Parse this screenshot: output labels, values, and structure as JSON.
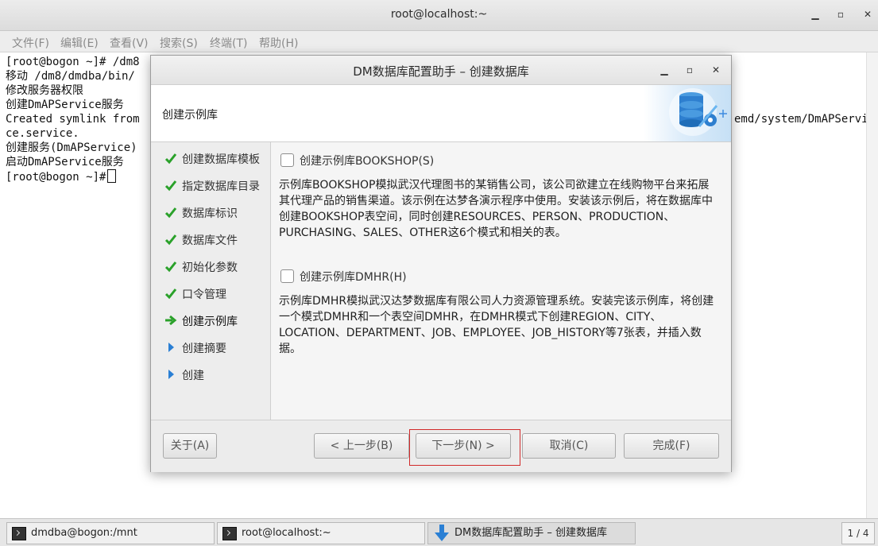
{
  "terminal": {
    "title": "root@localhost:~",
    "menu": [
      "文件(F)",
      "编辑(E)",
      "查看(V)",
      "搜索(S)",
      "终端(T)",
      "帮助(H)"
    ],
    "lines": [
      "[root@bogon ~]# /dm8",
      "移动 /dm8/dmdba/bin/",
      "修改服务器权限",
      "创建DmAPService服务",
      "Created symlink from",
      "ce.service.",
      "创建服务(DmAPService)",
      "启动DmAPService服务",
      "[root@bogon ~]#"
    ],
    "right_fragment": "emd/system/DmAPServi"
  },
  "dialog": {
    "title": "DM数据库配置助手 – 创建数据库",
    "header_title": "创建示例库",
    "steps": [
      {
        "label": "创建数据库模板",
        "status": "done"
      },
      {
        "label": "指定数据库目录",
        "status": "done"
      },
      {
        "label": "数据库标识",
        "status": "done"
      },
      {
        "label": "数据库文件",
        "status": "done"
      },
      {
        "label": "初始化参数",
        "status": "done"
      },
      {
        "label": "口令管理",
        "status": "done"
      },
      {
        "label": "创建示例库",
        "status": "current"
      },
      {
        "label": "创建摘要",
        "status": "pending"
      },
      {
        "label": "创建",
        "status": "pending"
      }
    ],
    "option_bookshop": {
      "label": "创建示例库BOOKSHOP(S)",
      "checked": false,
      "description": "示例库BOOKSHOP模拟武汉代理图书的某销售公司，该公司欲建立在线购物平台来拓展其代理产品的销售渠道。该示例在达梦各演示程序中使用。安装该示例后，将在数据库中创建BOOKSHOP表空间，同时创建RESOURCES、PERSON、PRODUCTION、PURCHASING、SALES、OTHER这6个模式和相关的表。"
    },
    "option_dmhr": {
      "label": "创建示例库DMHR(H)",
      "checked": false,
      "description": "示例库DMHR模拟武汉达梦数据库有限公司人力资源管理系统。安装完该示例库，将创建一个模式DMHR和一个表空间DMHR，在DMHR模式下创建REGION、CITY、LOCATION、DEPARTMENT、JOB、EMPLOYEE、JOB_HISTORY等7张表，并插入数据。"
    },
    "buttons": {
      "about": "关于(A)",
      "back": "< 上一步(B)",
      "next": "下一步(N) >",
      "cancel": "取消(C)",
      "finish": "完成(F)"
    }
  },
  "taskbar": {
    "tasks": [
      "dmdba@bogon:/mnt",
      "root@localhost:~",
      "DM数据库配置助手 – 创建数据库"
    ],
    "pager": "1 / 4"
  },
  "colors": {
    "check_green": "#2aa12a",
    "arrow_blue": "#2a7fd4",
    "highlight_red": "#d12a2a"
  }
}
